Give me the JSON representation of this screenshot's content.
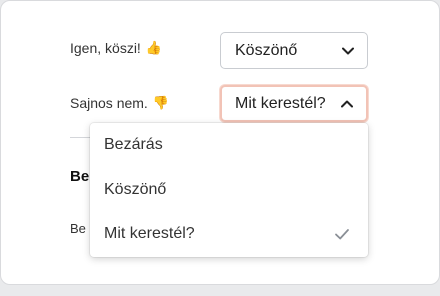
{
  "form": {
    "yes_label": "Igen, köszi!",
    "yes_emoji": "👍",
    "yes_select_value": "Köszönő",
    "no_label": "Sajnos nem.",
    "no_emoji": "👎",
    "no_select_value": "Mit kerestél?"
  },
  "section": {
    "heading_partial": "Be",
    "text_partial": "Be"
  },
  "dropdown": {
    "options": [
      {
        "label": "Bezárás",
        "selected": false
      },
      {
        "label": "Köszönő",
        "selected": false
      },
      {
        "label": "Mit kerestél?",
        "selected": true
      }
    ]
  },
  "colors": {
    "focus_border": "#f2c3b6",
    "check": "#8a8f96"
  },
  "icons": {
    "yes_chevron": "chevron-down-icon",
    "no_chevron": "chevron-up-icon",
    "selected": "check-icon"
  }
}
